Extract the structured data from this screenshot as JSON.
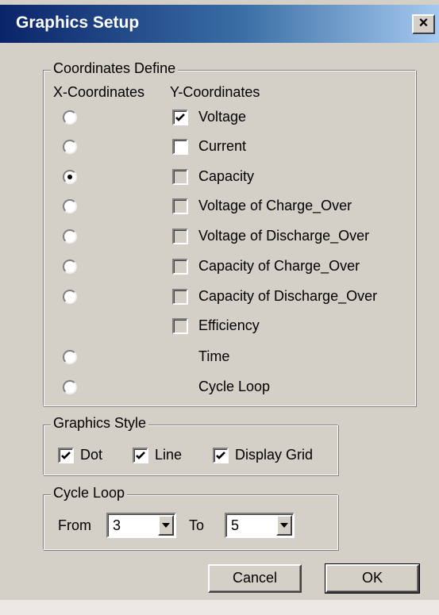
{
  "window": {
    "title": "Graphics Setup",
    "close_glyph": "×"
  },
  "coordinates": {
    "group_label": "Coordinates Define",
    "x_header": "X-Coordinates",
    "y_header": "Y-Coordinates",
    "rows": [
      {
        "label": "Voltage",
        "radio": true,
        "radio_checked": false,
        "checkbox": true,
        "checked": true,
        "disabled": false
      },
      {
        "label": "Current",
        "radio": true,
        "radio_checked": false,
        "checkbox": true,
        "checked": false,
        "disabled": false
      },
      {
        "label": "Capacity",
        "radio": true,
        "radio_checked": true,
        "checkbox": true,
        "checked": false,
        "disabled": true
      },
      {
        "label": "Voltage of Charge_Over",
        "radio": true,
        "radio_checked": false,
        "checkbox": true,
        "checked": false,
        "disabled": true
      },
      {
        "label": "Voltage of Discharge_Over",
        "radio": true,
        "radio_checked": false,
        "checkbox": true,
        "checked": false,
        "disabled": true
      },
      {
        "label": "Capacity of Charge_Over",
        "radio": true,
        "radio_checked": false,
        "checkbox": true,
        "checked": false,
        "disabled": true
      },
      {
        "label": "Capacity of Discharge_Over",
        "radio": true,
        "radio_checked": false,
        "checkbox": true,
        "checked": false,
        "disabled": true
      },
      {
        "label": "Efficiency",
        "radio": false,
        "radio_checked": false,
        "checkbox": true,
        "checked": false,
        "disabled": true
      },
      {
        "label": "Time",
        "radio": true,
        "radio_checked": false,
        "checkbox": false,
        "checked": false,
        "disabled": false
      },
      {
        "label": "Cycle Loop",
        "radio": true,
        "radio_checked": false,
        "checkbox": false,
        "checked": false,
        "disabled": false
      }
    ]
  },
  "graphics_style": {
    "group_label": "Graphics Style",
    "dot_label": "Dot",
    "dot_checked": true,
    "line_label": "Line",
    "line_checked": true,
    "grid_label": "Display Grid",
    "grid_checked": true
  },
  "cycle_loop": {
    "group_label": "Cycle Loop",
    "from_label": "From",
    "from_value": "3",
    "to_label": "To",
    "to_value": "5"
  },
  "buttons": {
    "cancel_label": "Cancel",
    "ok_label": "OK"
  }
}
